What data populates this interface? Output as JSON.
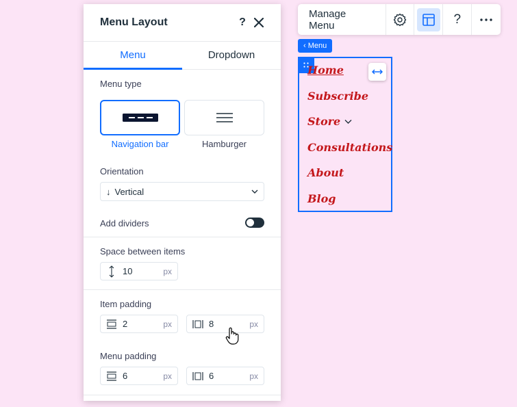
{
  "panel": {
    "title": "Menu Layout",
    "help_label": "?",
    "tabs": [
      {
        "label": "Menu",
        "active": true
      },
      {
        "label": "Dropdown",
        "active": false
      }
    ],
    "menu_type": {
      "label": "Menu type",
      "options": [
        {
          "label": "Navigation bar",
          "selected": true
        },
        {
          "label": "Hamburger",
          "selected": false
        }
      ]
    },
    "orientation": {
      "label": "Orientation",
      "value": "Vertical",
      "icon": "arrow-down-icon"
    },
    "add_dividers": {
      "label": "Add dividers",
      "on": false
    },
    "space_between": {
      "label": "Space between items",
      "value": "10",
      "unit": "px"
    },
    "item_padding": {
      "label": "Item padding",
      "vertical": {
        "value": "2",
        "unit": "px"
      },
      "horizontal": {
        "value": "8",
        "unit": "px"
      }
    },
    "menu_padding": {
      "label": "Menu padding",
      "vertical": {
        "value": "6",
        "unit": "px"
      },
      "horizontal": {
        "value": "6",
        "unit": "px"
      }
    }
  },
  "toolbar": {
    "manage_label": "Manage Menu",
    "help_label": "?",
    "icons": [
      "gear-icon",
      "layout-icon",
      "help-icon",
      "more-icon"
    ]
  },
  "canvas": {
    "tag_label": "Menu",
    "items": [
      {
        "label": "Home",
        "current": true
      },
      {
        "label": "Subscribe"
      },
      {
        "label": "Store",
        "has_dropdown": true
      },
      {
        "label": "Consultations"
      },
      {
        "label": "About"
      },
      {
        "label": "Blog"
      }
    ]
  },
  "colors": {
    "accent": "#116dff",
    "menu_text": "#c4181c",
    "background": "#fce4f6"
  }
}
